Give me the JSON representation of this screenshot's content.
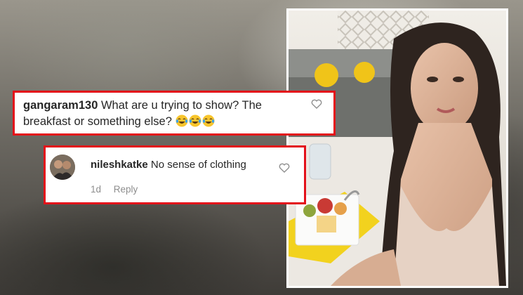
{
  "comment1": {
    "username": "gangaram130",
    "text": "What are u trying to show? The breakfast or something else?",
    "emojis": [
      "laughing-tears-emoji",
      "laughing-tears-emoji",
      "laughing-tears-emoji"
    ]
  },
  "comment2": {
    "username": "nileshkatke",
    "text": "No sense of clothing",
    "time": "1d",
    "reply_label": "Reply"
  },
  "icons": {
    "like": "heart-icon"
  },
  "colors": {
    "highlight_border": "#e3111a",
    "username": "#262626",
    "meta": "#8e8e8e"
  }
}
